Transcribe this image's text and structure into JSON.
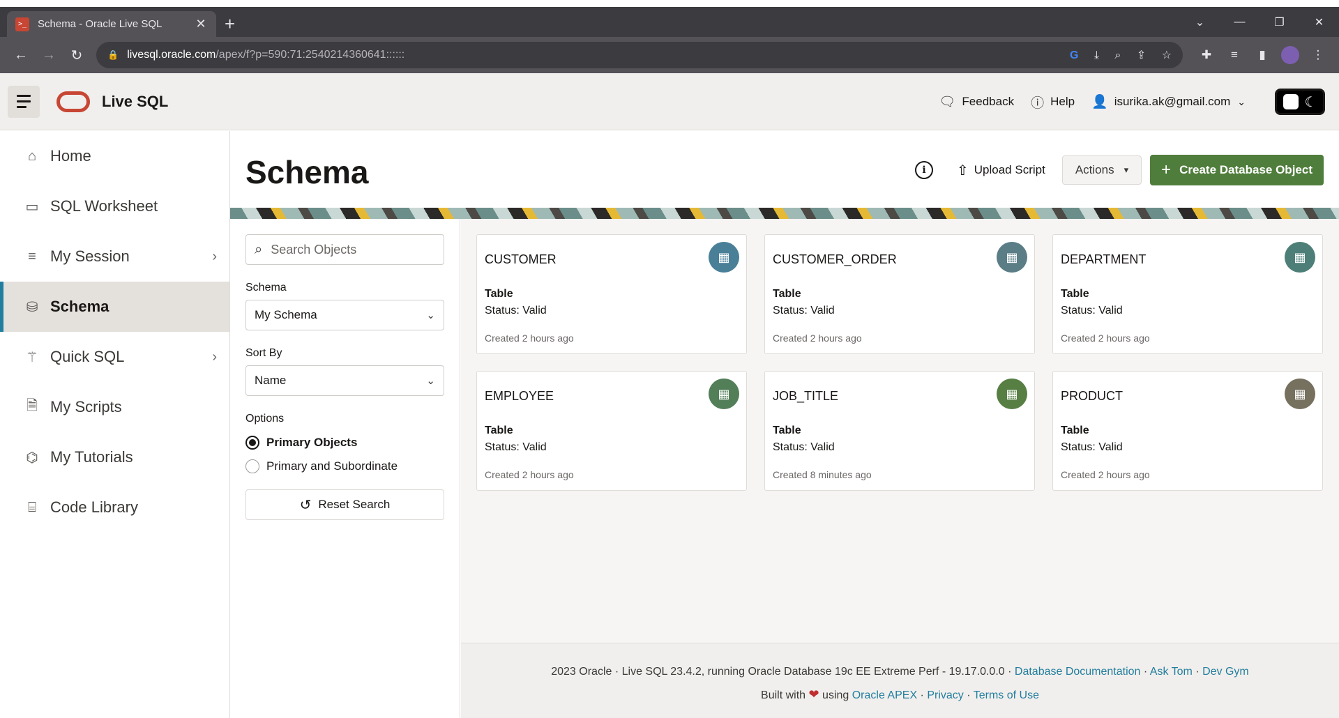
{
  "browser": {
    "tab_title": "Schema - Oracle Live SQL",
    "favicon_text": ">_",
    "url_domain": "livesql.oracle.com",
    "url_path": "/apex/f?p=590:71:2540214360641::::::"
  },
  "app": {
    "brand": "Live SQL",
    "header": {
      "feedback": "Feedback",
      "help": "Help",
      "user": "isurika.ak@gmail.com"
    }
  },
  "sidebar": {
    "items": [
      {
        "label": "Home",
        "icon": "home-icon"
      },
      {
        "label": "SQL Worksheet",
        "icon": "terminal-icon"
      },
      {
        "label": "My Session",
        "icon": "list-icon"
      },
      {
        "label": "Schema",
        "icon": "database-icon"
      },
      {
        "label": "Quick SQL",
        "icon": "wand-icon"
      },
      {
        "label": "My Scripts",
        "icon": "document-icon"
      },
      {
        "label": "My Tutorials",
        "icon": "graduation-cap-icon"
      },
      {
        "label": "Code Library",
        "icon": "library-icon"
      }
    ]
  },
  "page": {
    "title": "Schema",
    "upload_label": "Upload Script",
    "actions_label": "Actions",
    "create_label": "Create Database Object"
  },
  "filters": {
    "search_placeholder": "Search Objects",
    "schema_label": "Schema",
    "schema_value": "My Schema",
    "sort_label": "Sort By",
    "sort_value": "Name",
    "options_label": "Options",
    "option_primary": "Primary Objects",
    "option_subordinate": "Primary and Subordinate",
    "reset_label": "Reset Search"
  },
  "cards": [
    {
      "name": "CUSTOMER",
      "type": "Table",
      "status": "Status: Valid",
      "created": "Created 2 hours ago",
      "color": "#4a7f98"
    },
    {
      "name": "CUSTOMER_ORDER",
      "type": "Table",
      "status": "Status: Valid",
      "created": "Created 2 hours ago",
      "color": "#5a7d86"
    },
    {
      "name": "DEPARTMENT",
      "type": "Table",
      "status": "Status: Valid",
      "created": "Created 2 hours ago",
      "color": "#4d7f78"
    },
    {
      "name": "EMPLOYEE",
      "type": "Table",
      "status": "Status: Valid",
      "created": "Created 2 hours ago",
      "color": "#527e58"
    },
    {
      "name": "JOB_TITLE",
      "type": "Table",
      "status": "Status: Valid",
      "created": "Created 8 minutes ago",
      "color": "#577f44"
    },
    {
      "name": "PRODUCT",
      "type": "Table",
      "status": "Status: Valid",
      "created": "Created 2 hours ago",
      "color": "#76705f"
    }
  ],
  "footer": {
    "line1_text": "2023 Oracle · Live SQL 23.4.2, running Oracle Database 19c EE Extreme Perf - 19.17.0.0.0 · ",
    "link_docs": "Database Documentation",
    "sep": " · ",
    "link_asktom": "Ask Tom",
    "link_devgym": "Dev Gym",
    "built_with": "Built with ",
    "using": " using ",
    "link_apex": "Oracle APEX",
    "link_privacy": "Privacy",
    "link_terms": "Terms of Use"
  }
}
